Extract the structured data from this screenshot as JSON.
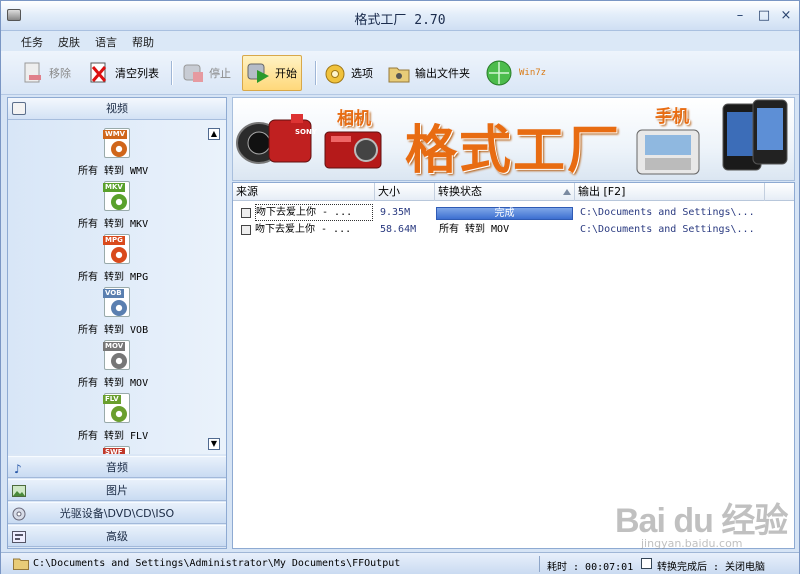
{
  "window": {
    "title": "格式工厂 2.70"
  },
  "menu": [
    "任务",
    "皮肤",
    "语言",
    "帮助"
  ],
  "toolbar": {
    "remove": "移除",
    "clear": "清空列表",
    "stop": "停止",
    "start": "开始",
    "options": "选项",
    "output_folder": "输出文件夹",
    "win7": "Win7z"
  },
  "sidebar": {
    "video_header": "视频",
    "formats": [
      {
        "tag": "WMV",
        "label": "所有 转到 WMV",
        "color": "#d0661a"
      },
      {
        "tag": "MKV",
        "label": "所有 转到 MKV",
        "color": "#5aa12c"
      },
      {
        "tag": "MPG",
        "label": "所有 转到 MPG",
        "color": "#d94a1c"
      },
      {
        "tag": "VOB",
        "label": "所有 转到 VOB",
        "color": "#5a7fb0"
      },
      {
        "tag": "MOV",
        "label": "所有 转到 MOV",
        "color": "#777777"
      },
      {
        "tag": "FLV",
        "label": "所有 转到 FLV",
        "color": "#6a9f2e"
      },
      {
        "tag": "SWF",
        "label": "",
        "color": "#c0392b"
      }
    ],
    "categories": [
      "音频",
      "图片",
      "光驱设备\\DVD\\CD\\ISO",
      "高级"
    ]
  },
  "banner": {
    "camera": "相机",
    "brand": "格式工厂",
    "phone": "手机",
    "camera_brand": "SONY"
  },
  "list": {
    "headers": {
      "source": "来源",
      "size": "大小",
      "status": "转换状态",
      "output": "输出 [F2]"
    },
    "rows": [
      {
        "source": "吻下去爱上你 - ...",
        "size": "9.35M",
        "status": "完成",
        "output": "C:\\Documents and Settings\\..."
      },
      {
        "source": "吻下去爱上你 - ...",
        "size": "58.64M",
        "status": "所有 转到 MOV",
        "output": "C:\\Documents and Settings\\..."
      }
    ]
  },
  "statusbar": {
    "path": "C:\\Documents and Settings\\Administrator\\My Documents\\FFOutput",
    "elapsed": "耗时 : 00:07:01",
    "after_convert": "转换完成后 : 关闭电脑"
  },
  "watermark": {
    "text": "Bai du 经验",
    "sub": "jingyan.baidu.com"
  }
}
